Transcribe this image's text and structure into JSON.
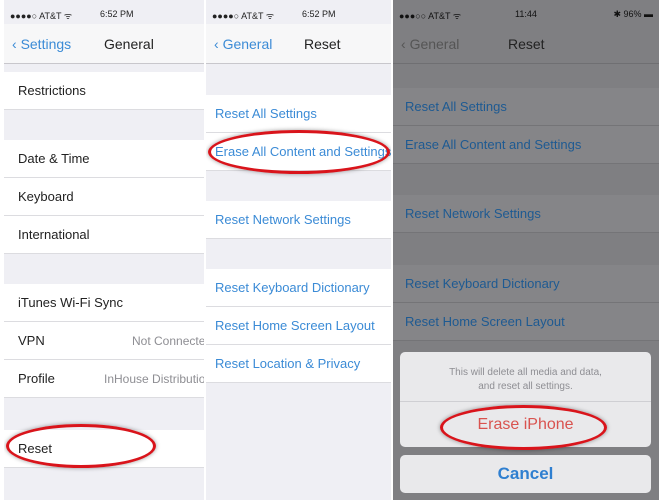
{
  "panel1": {
    "status": {
      "carrier": "●●●●○ AT&T ᯤ",
      "time": "6:52 PM"
    },
    "back": "Settings",
    "title": "General",
    "rows": [
      {
        "label": "Restrictions"
      },
      {
        "label": "Date & Time"
      },
      {
        "label": "Keyboard"
      },
      {
        "label": "International"
      },
      {
        "label": "iTunes Wi-Fi Sync"
      },
      {
        "label": "VPN",
        "value": "Not Connected"
      },
      {
        "label": "Profile",
        "value": "InHouse Distribution"
      },
      {
        "label": "Reset"
      }
    ]
  },
  "panel2": {
    "status": {
      "carrier": "●●●●○ AT&T ᯤ",
      "time": "6:52 PM"
    },
    "back": "General",
    "title": "Reset",
    "rows": [
      "Reset All Settings",
      "Erase All Content and Settings",
      "Reset Network Settings",
      "Reset Keyboard Dictionary",
      "Reset Home Screen Layout",
      "Reset Location & Privacy"
    ]
  },
  "panel3": {
    "status": {
      "carrier": "●●●○○ AT&T ᯤ",
      "time": "11:44",
      "battery": "✱ 96% ▬"
    },
    "back": "General",
    "title": "Reset",
    "rows": [
      "Reset All Settings",
      "Erase All Content and Settings",
      "Reset Network Settings",
      "Reset Keyboard Dictionary",
      "Reset Home Screen Layout"
    ],
    "sheet": {
      "message": "This will delete all media and data, and reset all settings.",
      "erase": "Erase iPhone",
      "cancel": "Cancel"
    }
  },
  "colors": {
    "accent": "#3b8bd6",
    "highlight": "#d9141b",
    "destructive": "#d9534f"
  }
}
